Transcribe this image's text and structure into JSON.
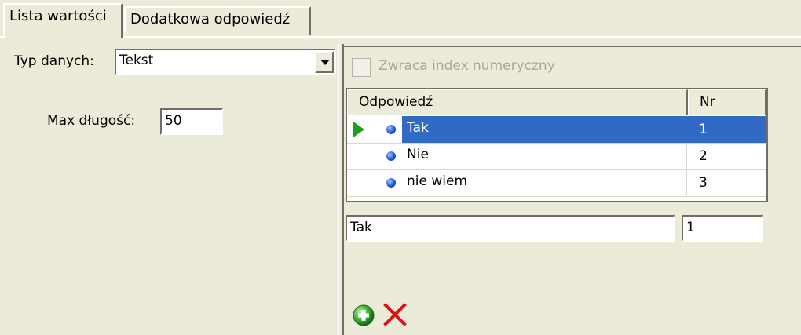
{
  "tabs": [
    {
      "label": "Lista wartości",
      "active": true
    },
    {
      "label": "Dodatkowa odpowiedź",
      "active": false
    }
  ],
  "left": {
    "type_label": "Typ danych:",
    "type_value": "Tekst",
    "maxlen_label": "Max długość:",
    "maxlen_value": "50"
  },
  "right": {
    "checkbox_label": "Zwraca index numeryczny",
    "checkbox_checked": false,
    "grid": {
      "headers": [
        "Odpowiedź",
        "Nr"
      ],
      "rows": [
        {
          "answer": "Tak",
          "nr": "1",
          "selected": true
        },
        {
          "answer": "Nie",
          "nr": "2",
          "selected": false
        },
        {
          "answer": "nie wiem",
          "nr": "3",
          "selected": false
        }
      ]
    },
    "edit_answer": "Tak",
    "edit_nr": "1"
  },
  "icons": {
    "current_row": "play-icon",
    "row_marker": "dot-icon",
    "add": "add-icon",
    "delete": "delete-icon"
  },
  "colors": {
    "selection": "#316ac5",
    "face": "#ecead8",
    "current_row_arrow": "#1aa31a",
    "delete": "#e01010"
  }
}
